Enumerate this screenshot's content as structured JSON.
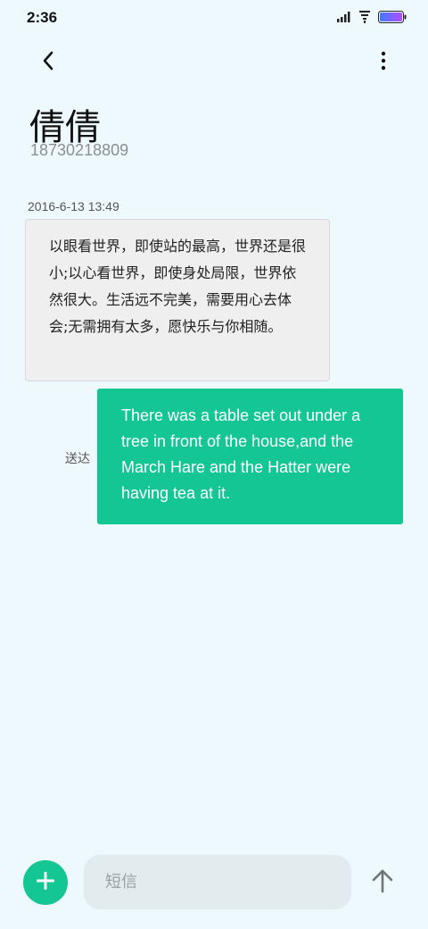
{
  "status_bar": {
    "time": "2:36",
    "icons": [
      "signal-icon",
      "wifi-icon",
      "battery-icon"
    ]
  },
  "header": {
    "back_icon": "chevron-left-icon",
    "more_icon": "more-vertical-icon",
    "contact_name": "倩倩",
    "contact_number": "18730218809"
  },
  "conversation": {
    "timestamp": "2016-6-13 13:49",
    "incoming_message": "以眼看世界，即使站的最高，世界还是很小;以心看世界，即使身处局限，世界依然很大。生活远不完美，需要用心去体会;无需拥有太多，愿快乐与你相随。",
    "outgoing_message": "There was a table set out under a tree in front of the house,and the March Hare and the Hatter were having tea at it.",
    "outgoing_status": "送达"
  },
  "composer": {
    "attach_icon": "plus-icon",
    "placeholder": "短信",
    "value": "",
    "send_icon": "arrow-up-icon"
  },
  "colors": {
    "background": "#eef9fd",
    "accent": "#13c694",
    "incoming_bubble": "#efefef",
    "input_background": "#e2ebee"
  }
}
